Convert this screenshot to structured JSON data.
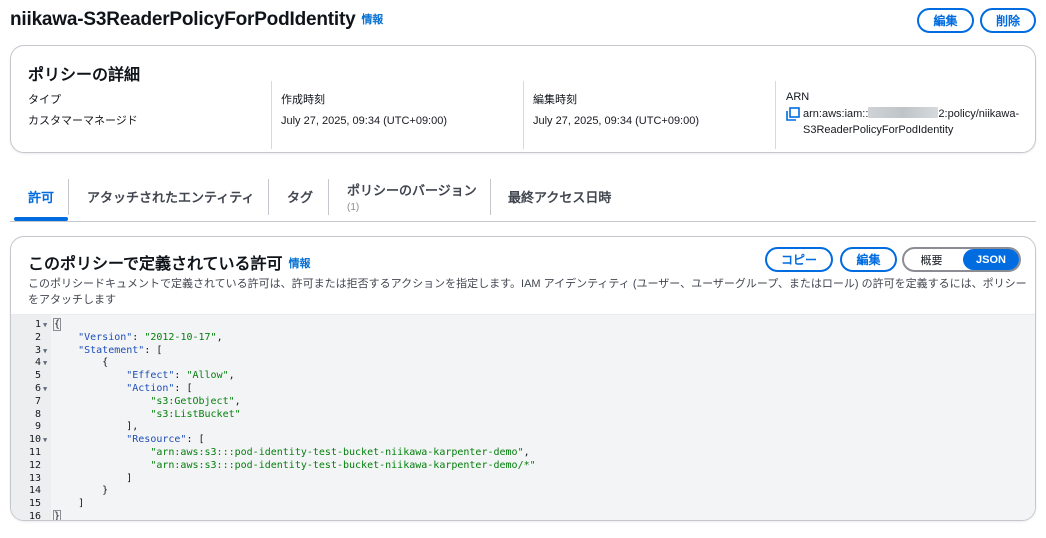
{
  "header": {
    "title": "niikawa-S3ReaderPolicyForPodIdentity",
    "info": "情報",
    "edit_label": "編集",
    "delete_label": "削除"
  },
  "details": {
    "title": "ポリシーの詳細",
    "type_label": "タイプ",
    "type_value": "カスタマーマネージド",
    "created_label": "作成時刻",
    "created_value": "July 27, 2025, 09:34 (UTC+09:00)",
    "edited_label": "編集時刻",
    "edited_value": "July 27, 2025, 09:34 (UTC+09:00)",
    "arn_label": "ARN",
    "arn_prefix": "arn:aws:iam::",
    "arn_suffix": "2:policy/niikawa-S3ReaderPolicyForPodIdentity"
  },
  "tabs": [
    {
      "label": "許可",
      "sub": ""
    },
    {
      "label": "アタッチされたエンティティ",
      "sub": ""
    },
    {
      "label": "タグ",
      "sub": ""
    },
    {
      "label": "ポリシーのバージョン",
      "sub": "(1)"
    },
    {
      "label": "最終アクセス日時",
      "sub": ""
    }
  ],
  "permissions": {
    "title": "このポリシーで定義されている許可",
    "info": "情報",
    "description": "このポリシードキュメントで定義されている許可は、許可または拒否するアクションを指定します。IAM アイデンティティ (ユーザー、ユーザーグループ、またはロール) の許可を定義するには、ポリシーをアタッチします",
    "copy_label": "コピー",
    "edit_label": "編集",
    "view_summary": "概要",
    "view_json": "JSON"
  },
  "colors": {
    "accent": "#006ce0",
    "json_key": "#1e4eb8",
    "json_string": "#037f0c"
  },
  "code_lines": [
    {
      "n": "1",
      "fold": true,
      "text": "{"
    },
    {
      "n": "2",
      "fold": false,
      "text": "    \"Version\": \"2012-10-17\","
    },
    {
      "n": "3",
      "fold": true,
      "text": "    \"Statement\": ["
    },
    {
      "n": "4",
      "fold": true,
      "text": "        {"
    },
    {
      "n": "5",
      "fold": false,
      "text": "            \"Effect\": \"Allow\","
    },
    {
      "n": "6",
      "fold": true,
      "text": "            \"Action\": ["
    },
    {
      "n": "7",
      "fold": false,
      "text": "                \"s3:GetObject\","
    },
    {
      "n": "8",
      "fold": false,
      "text": "                \"s3:ListBucket\""
    },
    {
      "n": "9",
      "fold": false,
      "text": "            ],"
    },
    {
      "n": "10",
      "fold": true,
      "text": "            \"Resource\": ["
    },
    {
      "n": "11",
      "fold": false,
      "text": "                \"arn:aws:s3:::pod-identity-test-bucket-niikawa-karpenter-demo\","
    },
    {
      "n": "12",
      "fold": false,
      "text": "                \"arn:aws:s3:::pod-identity-test-bucket-niikawa-karpenter-demo/*\""
    },
    {
      "n": "13",
      "fold": false,
      "text": "            ]"
    },
    {
      "n": "14",
      "fold": false,
      "text": "        }"
    },
    {
      "n": "15",
      "fold": false,
      "text": "    ]"
    },
    {
      "n": "16",
      "fold": false,
      "text": "}"
    }
  ]
}
